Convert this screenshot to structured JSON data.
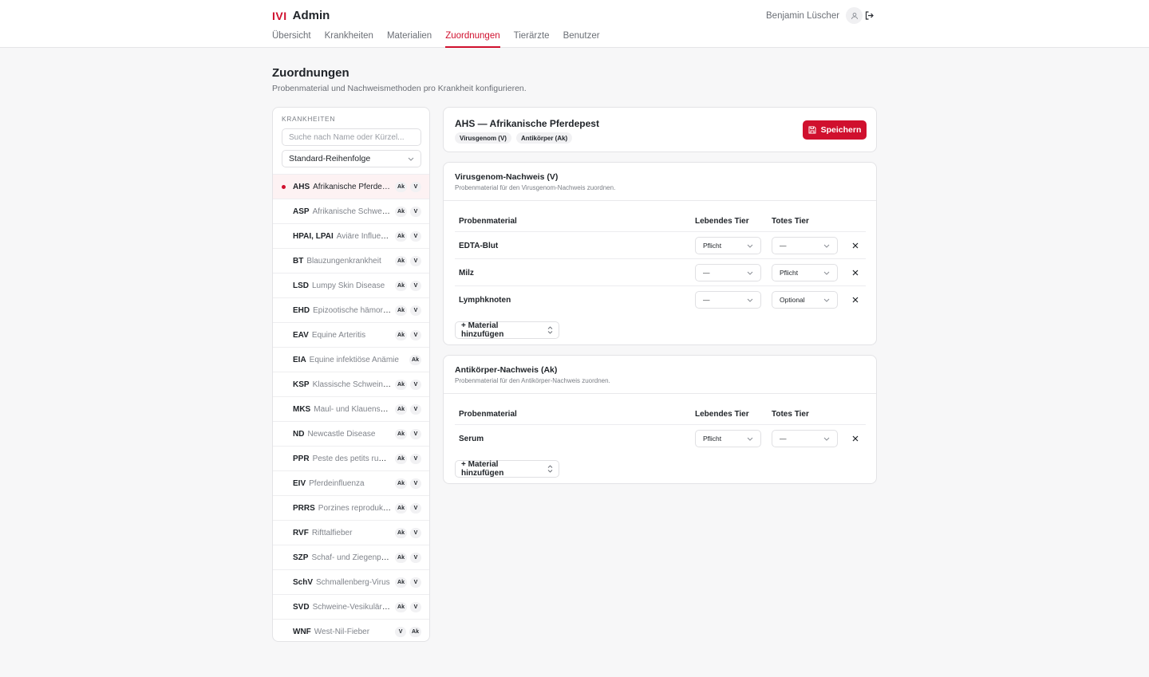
{
  "header": {
    "logo": "IVI",
    "app_title": "Admin",
    "nav": [
      "Übersicht",
      "Krankheiten",
      "Materialien",
      "Zuordnungen",
      "Tierärzte",
      "Benutzer"
    ],
    "active_nav": "Zuordnungen",
    "user_name": "Benjamin Lüscher",
    "user_icon": "user-icon",
    "logout_icon": "logout-icon"
  },
  "page": {
    "title": "Zuordnungen",
    "subtitle": "Probenmaterial und Nachweismethoden pro Krankheit konfigurieren."
  },
  "sidebar": {
    "heading": "Krankheiten",
    "search_placeholder": "Suche nach Name oder Kürzel...",
    "sort_value": "Standard-Reihenfolge",
    "items": [
      {
        "abbr": "AHS",
        "name": "Afrikanische Pferdepest",
        "badges": [
          "Ak",
          "V"
        ],
        "active": true
      },
      {
        "abbr": "ASP",
        "name": "Afrikanische Schweinepest",
        "badges": [
          "Ak",
          "V"
        ]
      },
      {
        "abbr": "HPAI, LPAI",
        "name": "Aviäre Influenza",
        "badges": [
          "Ak",
          "V"
        ]
      },
      {
        "abbr": "BT",
        "name": "Blauzungenkrankheit",
        "badges": [
          "Ak",
          "V"
        ]
      },
      {
        "abbr": "LSD",
        "name": "Lumpy Skin Disease",
        "badges": [
          "Ak",
          "V"
        ]
      },
      {
        "abbr": "EHD",
        "name": "Epizootische hämorrhagische Krankheit",
        "badges": [
          "Ak",
          "V"
        ]
      },
      {
        "abbr": "EAV",
        "name": "Equine Arteritis",
        "badges": [
          "Ak",
          "V"
        ]
      },
      {
        "abbr": "EIA",
        "name": "Equine infektiöse Anämie",
        "badges": [
          "Ak"
        ]
      },
      {
        "abbr": "KSP",
        "name": "Klassische Schweinepest",
        "badges": [
          "Ak",
          "V"
        ]
      },
      {
        "abbr": "MKS",
        "name": "Maul- und Klauenseuche",
        "badges": [
          "Ak",
          "V"
        ]
      },
      {
        "abbr": "ND",
        "name": "Newcastle Disease",
        "badges": [
          "Ak",
          "V"
        ]
      },
      {
        "abbr": "PPR",
        "name": "Peste des petits ruminants",
        "badges": [
          "Ak",
          "V"
        ]
      },
      {
        "abbr": "EIV",
        "name": "Pferdeinfluenza",
        "badges": [
          "Ak",
          "V"
        ]
      },
      {
        "abbr": "PRRS",
        "name": "Porzines reproduktives und respiratorisches Syndrom",
        "badges": [
          "Ak",
          "V"
        ]
      },
      {
        "abbr": "RVF",
        "name": "Rifttalfieber",
        "badges": [
          "Ak",
          "V"
        ]
      },
      {
        "abbr": "SZP",
        "name": "Schaf- und Ziegenpocken",
        "badges": [
          "Ak",
          "V"
        ]
      },
      {
        "abbr": "SchV",
        "name": "Schmallenberg-Virus",
        "badges": [
          "Ak",
          "V"
        ]
      },
      {
        "abbr": "SVD",
        "name": "Schweine-Vesikulärkrankheit",
        "badges": [
          "Ak",
          "V"
        ]
      },
      {
        "abbr": "WNF",
        "name": "West-Nil-Fieber",
        "badges": [
          "V",
          "Ak"
        ]
      }
    ]
  },
  "detail": {
    "title": "AHS — Afrikanische Pferdepest",
    "chips": [
      "Virusgenom (V)",
      "Antikörper (Ak)"
    ],
    "save_label": "Speichern",
    "sections": [
      {
        "title": "Virusgenom-Nachweis (V)",
        "description": "Probenmaterial für den Virusgenom-Nachweis zuordnen.",
        "columns": [
          "Probenmaterial",
          "Lebendes Tier",
          "Totes Tier"
        ],
        "rows": [
          {
            "material": "EDTA-Blut",
            "live": "Pflicht",
            "dead": "—"
          },
          {
            "material": "Milz",
            "live": "—",
            "dead": "Pflicht"
          },
          {
            "material": "Lymphknoten",
            "live": "—",
            "dead": "Optional"
          }
        ],
        "add_label": "+ Material hinzufügen"
      },
      {
        "title": "Antikörper-Nachweis (Ak)",
        "description": "Probenmaterial für den Antikörper-Nachweis zuordnen.",
        "columns": [
          "Probenmaterial",
          "Lebendes Tier",
          "Totes Tier"
        ],
        "rows": [
          {
            "material": "Serum",
            "live": "Pflicht",
            "dead": "—"
          }
        ],
        "add_label": "+ Material hinzufügen"
      }
    ]
  },
  "colors": {
    "accent": "#d0102e",
    "background": "#f7f7f8",
    "card": "#ffffff",
    "muted_text": "#80848b"
  }
}
